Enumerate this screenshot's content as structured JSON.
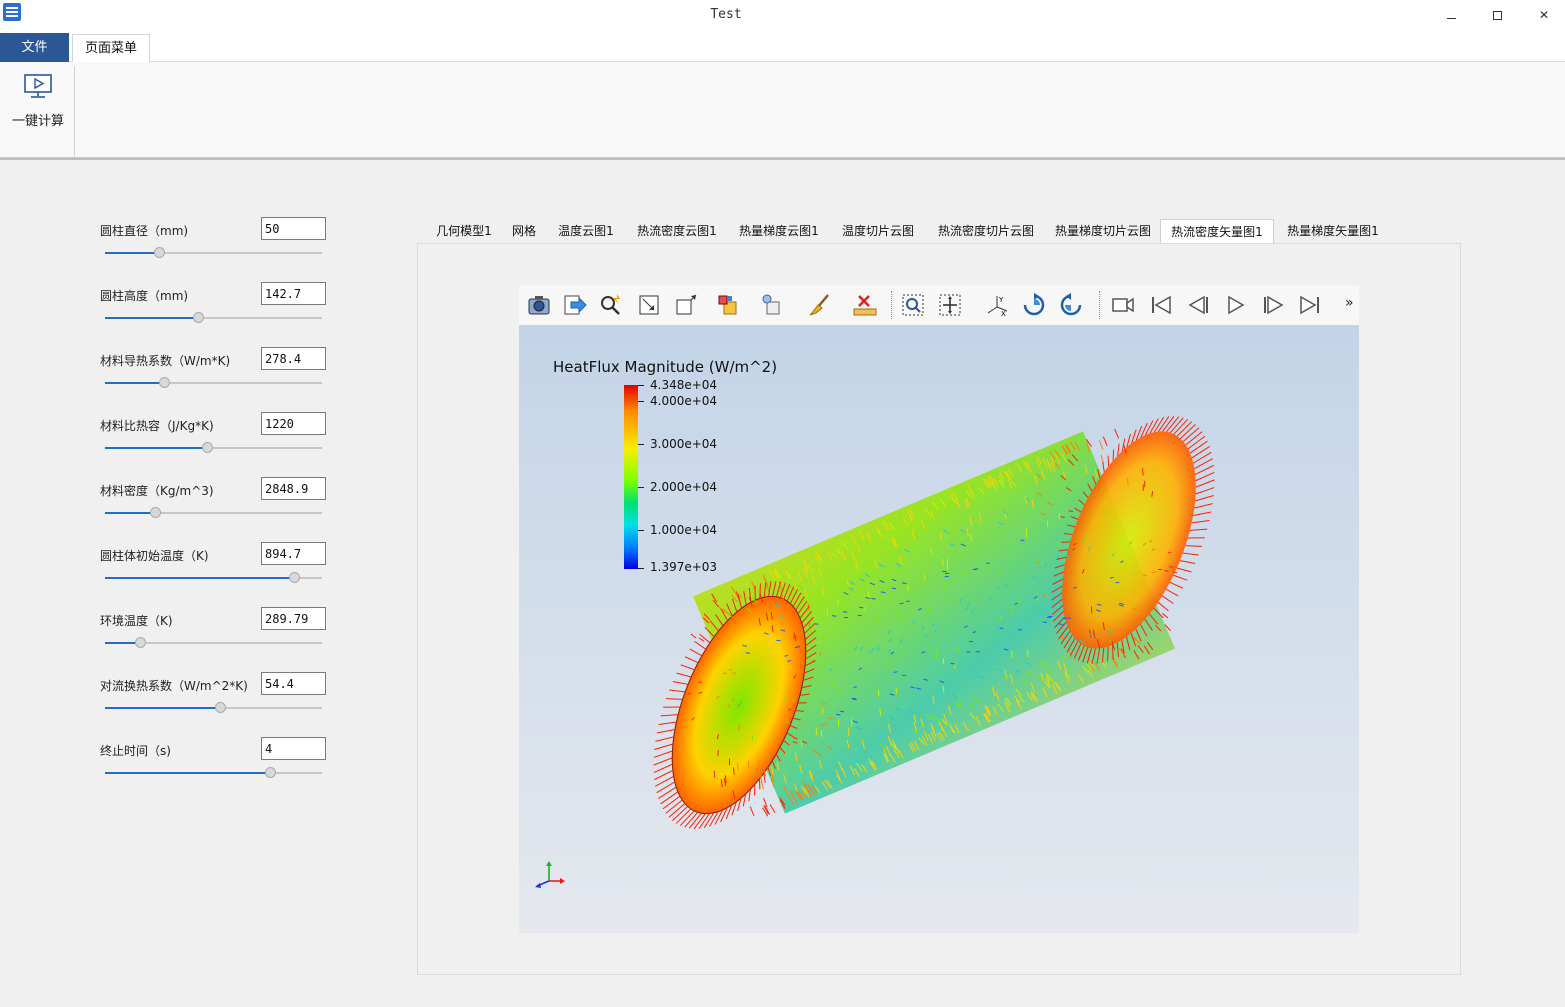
{
  "window": {
    "title": "Test",
    "minimize": "minimize",
    "maximize": "maximize",
    "close": "✕"
  },
  "menu": {
    "file_tab": "文件",
    "page_tab": "页面菜单"
  },
  "ribbon": {
    "calc_button_label": "一键计算"
  },
  "params": [
    {
      "label": "圆柱直径（mm)",
      "value": "50",
      "slider_fraction": 0.25
    },
    {
      "label": "圆柱高度（mm)",
      "value": "142.7",
      "slider_fraction": 0.43
    },
    {
      "label": "材料导热系数（W/m*K)",
      "value": "278.4",
      "slider_fraction": 0.27
    },
    {
      "label": "材料比热容（J/Kg*K)",
      "value": "1220",
      "slider_fraction": 0.47
    },
    {
      "label": "材料密度（Kg/m^3)",
      "value": "2848.9",
      "slider_fraction": 0.23
    },
    {
      "label": "圆柱体初始温度（K)",
      "value": "894.7",
      "slider_fraction": 0.87
    },
    {
      "label": "环境温度（K)",
      "value": "289.79",
      "slider_fraction": 0.16
    },
    {
      "label": "对流换热系数（W/m^2*K)",
      "value": "54.4",
      "slider_fraction": 0.53
    },
    {
      "label": "终止时间（s)",
      "value": "4",
      "slider_fraction": 0.76
    }
  ],
  "tabs": [
    {
      "label": "几何模型1",
      "active": false
    },
    {
      "label": "网格",
      "active": false
    },
    {
      "label": "温度云图1",
      "active": false
    },
    {
      "label": "热流密度云图1",
      "active": false
    },
    {
      "label": "热量梯度云图1",
      "active": false
    },
    {
      "label": "温度切片云图",
      "active": false
    },
    {
      "label": "热流密度切片云图",
      "active": false
    },
    {
      "label": "热量梯度切片云图",
      "active": false
    },
    {
      "label": "热流密度矢量图1",
      "active": true
    },
    {
      "label": "热量梯度矢量图1",
      "active": false
    }
  ],
  "viewer": {
    "toolbar_icons": [
      "camera-icon",
      "export-icon",
      "zoom-search-icon",
      "fit-view-icon",
      "box-view-icon",
      "display-mode-icon",
      "display-style-icon",
      "clear-brush-icon",
      "ruler-delete-icon",
      "zoom-box-icon",
      "pan-icon",
      "axes-orientation-icon",
      "rotate-cw-icon",
      "rotate-ccw-icon",
      "video-camera-icon",
      "first-frame-icon",
      "previous-frame-icon",
      "play-icon",
      "next-frame-icon",
      "last-frame-icon"
    ],
    "more": "»",
    "legend": {
      "title": "HeatFlux Magnitude (W/m^2)",
      "max": "4.348e+04",
      "ticks": [
        "4.000e+04",
        "3.000e+04",
        "2.000e+04",
        "1.000e+04"
      ],
      "min": "1.397e+03"
    }
  }
}
